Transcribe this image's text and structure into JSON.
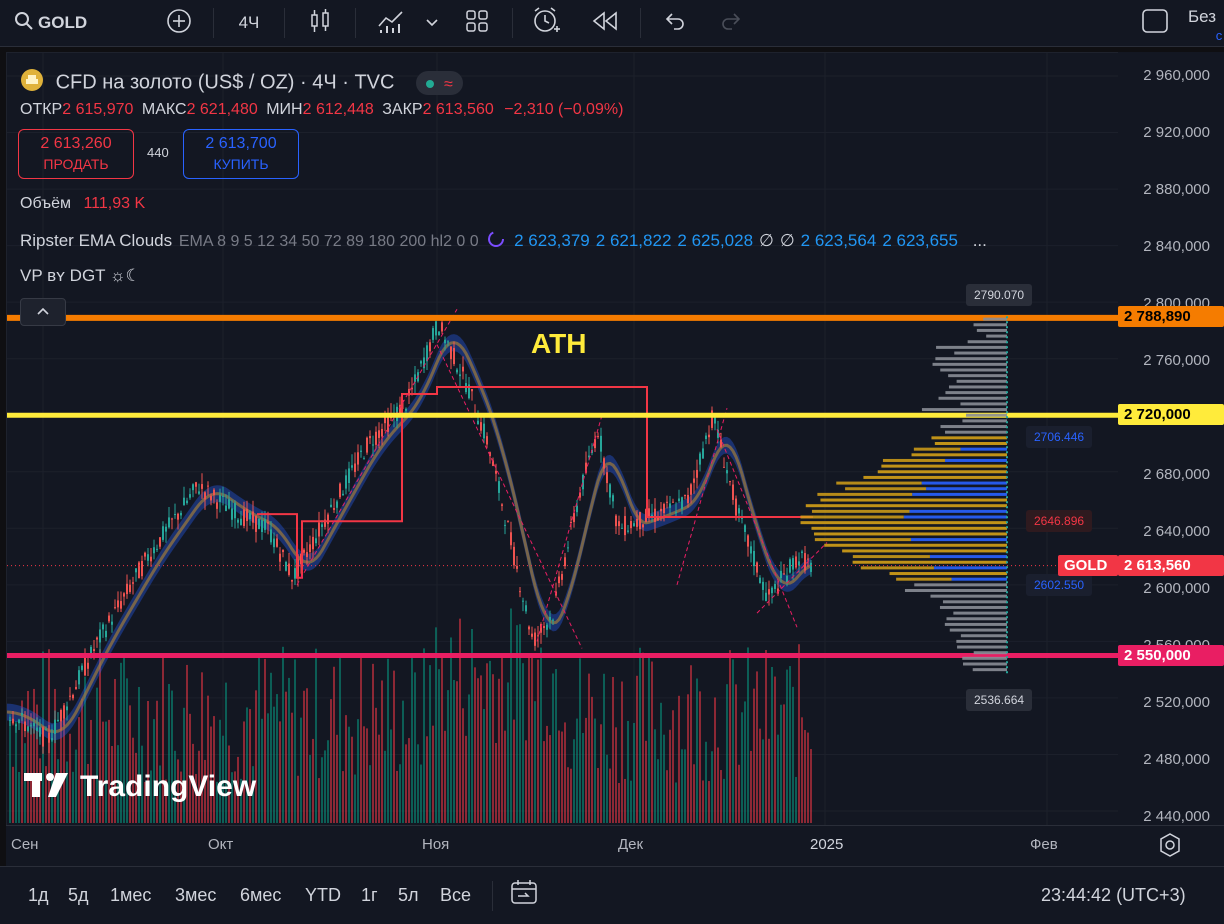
{
  "topbar": {
    "symbol": "GOLD",
    "interval": "4Ч",
    "right_label": "Без",
    "right_sub": "с"
  },
  "legend": {
    "title": "CFD на золото (US$ / OZ) · 4Ч · TVC",
    "ohlc": {
      "open_label": "ОТКР",
      "open": "2 615,970",
      "high_label": "МАКС",
      "high": "2 621,480",
      "low_label": "МИН",
      "low": "2 612,448",
      "close_label": "ЗАКР",
      "close": "2 613,560",
      "change": "−2,310 (−0,09%)"
    },
    "sell_price": "2 613,260",
    "sell_label": "ПРОДАТЬ",
    "spread": "440",
    "buy_price": "2 613,700",
    "buy_label": "КУПИТЬ",
    "volume_label": "Объём",
    "volume_value": "111,93 K",
    "indicator_name": "Ripster EMA Clouds",
    "indicator_params": "EMA 8 9 5 12 34 50 72 89 180 200 hl2 0 0",
    "indicator_values": [
      "2 623,379",
      "2 621,822",
      "2 625,028",
      "∅",
      "∅",
      "2 623,564",
      "2 623,655"
    ],
    "indicator_more": "...",
    "vp_label": "VP ʙʏ DGT ☼☾",
    "ath_label": "ATH"
  },
  "price_axis": {
    "ticks": [
      "2 960,000",
      "2 920,000",
      "2 880,000",
      "2 840,000",
      "2 800,000",
      "2 760,000",
      "2 720,000",
      "2 680,000",
      "2 640,000",
      "2 600,000",
      "2 560,000",
      "2 520,000",
      "2 480,000",
      "2 440,000"
    ],
    "level_orange": "2 788,890",
    "level_yellow": "2 720,000",
    "level_pink": "2 550,000",
    "current_symbol": "GOLD",
    "current_price": "2 613,560"
  },
  "vp_labels": {
    "top": "2790.070",
    "vah": "2706.446",
    "poc": "2646.896",
    "val": "2602.550",
    "bottom": "2536.664"
  },
  "time_axis": [
    "Сен",
    "Окт",
    "Ноя",
    "Дек",
    "2025",
    "Фев"
  ],
  "bottombar": {
    "ranges": [
      "1д",
      "5д",
      "1мес",
      "3мес",
      "6мес",
      "YTD",
      "1г",
      "5л",
      "Все"
    ],
    "clock": "23:44:42 (UTC+3)"
  },
  "watermark": "TradingView",
  "colors": {
    "orange": "#f57c00",
    "yellow": "#ffeb3b",
    "pink": "#e91e63",
    "red": "#f23645",
    "blue": "#2962ff",
    "green": "#089981"
  }
}
